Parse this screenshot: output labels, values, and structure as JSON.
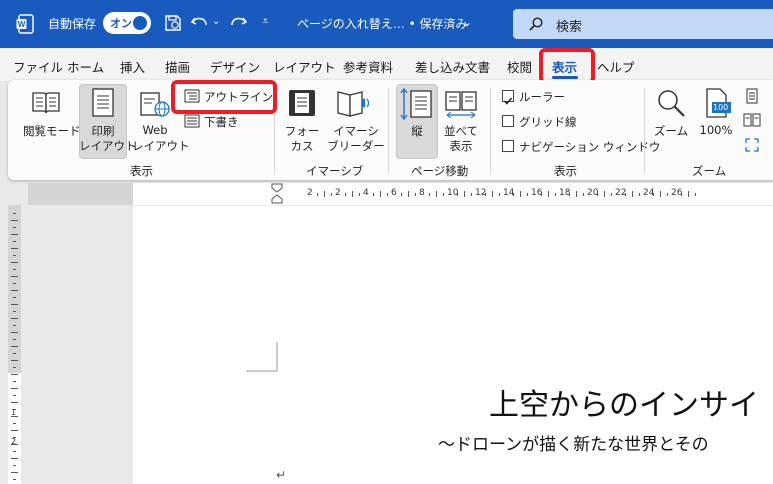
{
  "titlebar": {
    "autosave_label": "自動保存",
    "autosave_toggle": "オン",
    "document_title": "ページの入れ替え… • 保存済み",
    "search_placeholder": "検索",
    "colors": {
      "bg": "#185abd",
      "search_bg": "#c2d8f5"
    }
  },
  "menu": {
    "items": [
      "ファイル",
      "ホーム",
      "挿入",
      "描画",
      "デザイン",
      "レイアウト",
      "参考資料",
      "差し込み文書",
      "校閲",
      "表示",
      "ヘルプ"
    ],
    "active": "表示"
  },
  "ribbon": {
    "views": {
      "read_mode": "閲覧モード",
      "print_layout_1": "印刷",
      "print_layout_2": "レイアウト",
      "web_layout_1": "Web",
      "web_layout_2": "レイアウト",
      "outline": "アウトライン",
      "draft": "下書き",
      "group_label": "表示"
    },
    "immersive": {
      "focus_1": "フォー",
      "focus_2": "カス",
      "reader_1": "イマーシ",
      "reader_2": "ブリーダー",
      "group_label": "イマーシブ"
    },
    "page_movement": {
      "vertical": "縦",
      "side_1": "並べて",
      "side_2": "表示",
      "group_label": "ページ移動"
    },
    "show": {
      "ruler": "ルーラー",
      "ruler_checked": true,
      "gridlines": "グリッド線",
      "nav_pane": "ナビゲーション ウィンドウ",
      "group_label": "表示"
    },
    "zoom": {
      "zoom": "ズーム",
      "hundred": "100%",
      "hundred_icon_text": "100",
      "group_label": "ズーム"
    }
  },
  "ruler": {
    "top_numbers": [
      "2",
      "2",
      "4",
      "6",
      "8",
      "10",
      "12",
      "14",
      "16",
      "18",
      "20",
      "22",
      "24",
      "26"
    ],
    "left_numbers": [
      "1",
      "2"
    ]
  },
  "document": {
    "heading": "上空からのインサイ",
    "subtitle": "〜ドローンが描く新たな世界とその",
    "para_mark": "↵"
  },
  "highlight_color": "#ee1c25"
}
